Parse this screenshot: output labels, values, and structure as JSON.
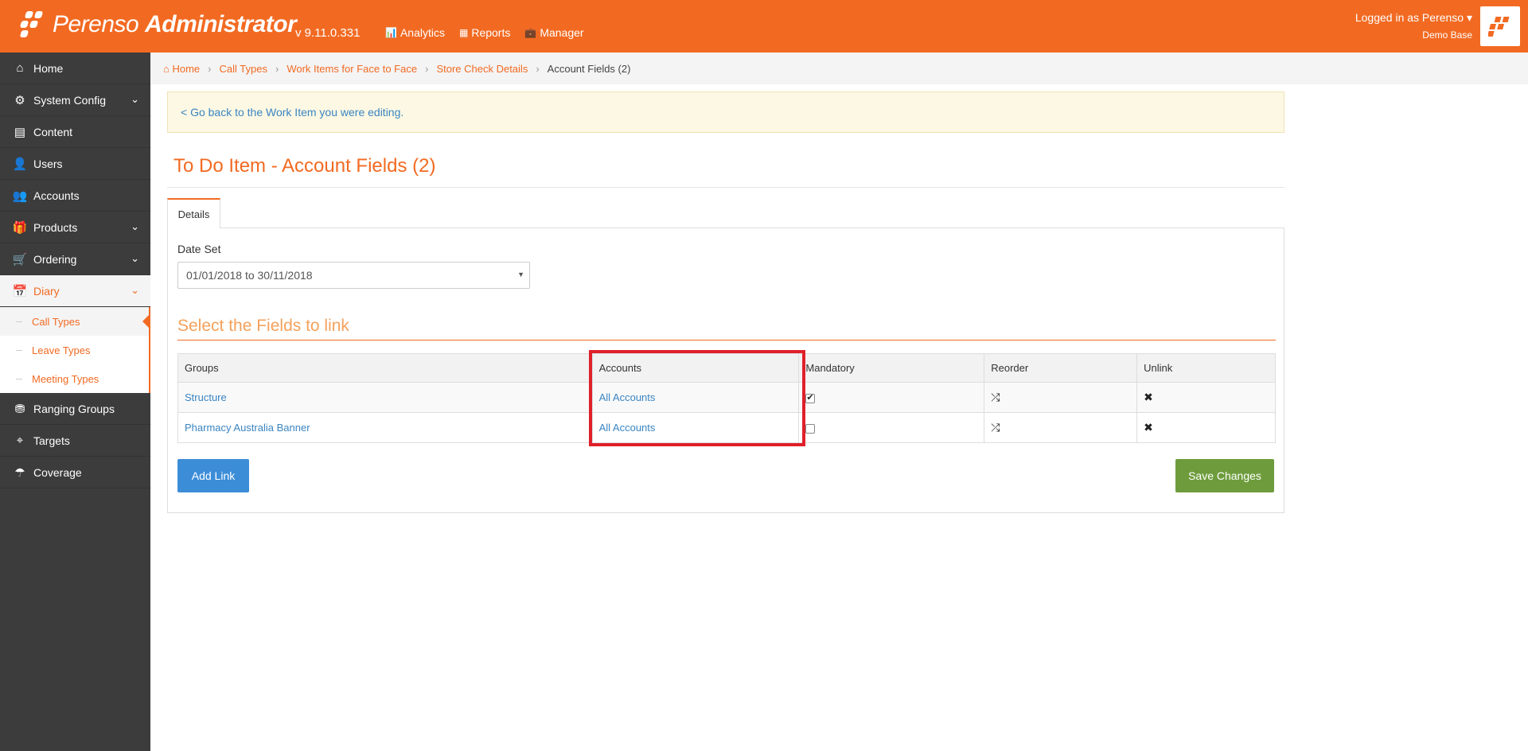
{
  "app": {
    "brand_regular": "Perenso",
    "brand_bold": "Administrator",
    "version": "v 9.11.0.331",
    "login_text": "Logged in as Perenso",
    "login_caret": "▾",
    "database": "Demo Base"
  },
  "topnav": [
    {
      "icon": "📊",
      "label": "Analytics"
    },
    {
      "icon": "▦",
      "label": "Reports"
    },
    {
      "icon": "💼",
      "label": "Manager"
    }
  ],
  "sidebar": {
    "items": [
      {
        "icon": "⌂",
        "label": "Home"
      },
      {
        "icon": "⚙",
        "label": "System Config",
        "chevron": "⌄"
      },
      {
        "icon": "▤",
        "label": "Content"
      },
      {
        "icon": "👤",
        "label": "Users"
      },
      {
        "icon": "👥",
        "label": "Accounts"
      },
      {
        "icon": "🎁",
        "label": "Products",
        "chevron": "⌄"
      },
      {
        "icon": "🛒",
        "label": "Ordering",
        "chevron": "⌄"
      },
      {
        "icon": "📅",
        "label": "Diary",
        "chevron": "⌄"
      }
    ],
    "diary_sub": [
      "Call Types",
      "Leave Types",
      "Meeting Types"
    ],
    "items_after": [
      {
        "icon": "⛃",
        "label": "Ranging Groups"
      },
      {
        "icon": "⌖",
        "label": "Targets"
      },
      {
        "icon": "☂",
        "label": "Coverage"
      }
    ]
  },
  "breadcrumb": {
    "home_icon": "⌂",
    "home": "Home",
    "items": [
      "Call Types",
      "Work Items for Face to Face",
      "Store Check Details"
    ],
    "separator": "›",
    "current": "Account Fields (2)"
  },
  "alert": {
    "text": "< Go back to the Work Item you were editing."
  },
  "page": {
    "title": "To Do Item - Account Fields (2)"
  },
  "tabs": {
    "details": "Details"
  },
  "form": {
    "date_set_label": "Date Set",
    "date_set_value": "01/01/2018 to 30/11/2018",
    "select_caret": "▼"
  },
  "section": {
    "title": "Select the Fields to link"
  },
  "table": {
    "headers": [
      "Groups",
      "Accounts",
      "Mandatory",
      "Reorder",
      "Unlink"
    ],
    "rows": [
      {
        "group": "Structure",
        "accounts": "All Accounts",
        "mandatory": true
      },
      {
        "group": "Pharmacy Australia Banner",
        "accounts": "All Accounts",
        "mandatory": false
      }
    ],
    "reorder_icon": "⤮",
    "unlink_icon": "✖"
  },
  "buttons": {
    "add_link": "Add Link",
    "save_changes": "Save Changes"
  },
  "colors": {
    "brand": "#f26a22",
    "sidebar": "#3c3c3c",
    "primary": "#3c8dd8",
    "success": "#6e9c3c",
    "highlight": "#e0202a"
  }
}
